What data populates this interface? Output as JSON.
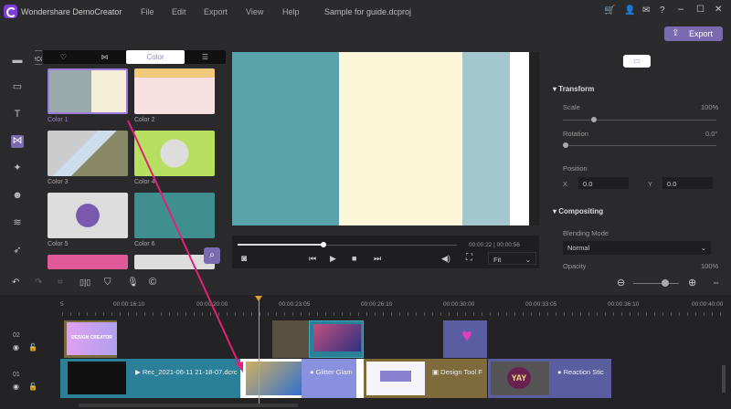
{
  "app": {
    "title": "Wondershare DemoCreator",
    "project": "Sample for guide.dcproj"
  },
  "menu": [
    "File",
    "Edit",
    "Export",
    "View",
    "Help"
  ],
  "toolbar": {
    "record": "Record",
    "export": "Export"
  },
  "panel": {
    "tabs": [
      "Favorites",
      "Transitions",
      "Color",
      "List"
    ],
    "active_tab": "Color",
    "items": [
      {
        "label": "Color 1",
        "selected": true
      },
      {
        "label": "Color 2"
      },
      {
        "label": "Color 3"
      },
      {
        "label": "Color 4"
      },
      {
        "label": "Color 5"
      },
      {
        "label": "Color 6"
      }
    ]
  },
  "player": {
    "current": "00:00:22",
    "total": "00:00:56",
    "time_display": "00:00:22 | 00:00:56",
    "progress": 0.39,
    "zoom": "Fit"
  },
  "properties": {
    "transform": "Transform",
    "scale_label": "Scale",
    "scale": "100%",
    "rotation_label": "Rotation",
    "rotation": "0.0°",
    "position_label": "Position",
    "x_label": "X",
    "x": "0.0",
    "y_label": "Y",
    "y": "0.0",
    "compositing": "Compositing",
    "blend_label": "Blending Mode",
    "blend": "Normal",
    "opacity_label": "Opacity",
    "opacity": "100%"
  },
  "timeline": {
    "ruler": [
      "5",
      "00:00:16:10",
      "00:00:20:00",
      "00:00:23:05",
      "00:00:26:10",
      "00:00:30:00",
      "00:00:33:05",
      "00:00:36:10",
      "00:00:40:00"
    ],
    "tracks": [
      "02",
      "01"
    ],
    "clips": {
      "rec": "Rec_2021-06-11 21-18-07.dcrc",
      "glitter": "Glitter Glam",
      "design": "Design Tool F",
      "reaction": "Reaction Stic",
      "design_creator": "DESIGN CREATOR"
    }
  },
  "colors": {
    "accent": "#7a6ab0",
    "playhead": "#e0a030",
    "arrow": "#e0207a",
    "selected": "#9b7be0"
  }
}
